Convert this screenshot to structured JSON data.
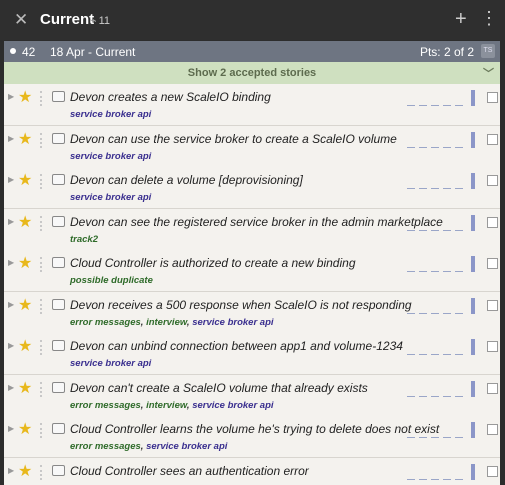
{
  "header": {
    "close": "✕",
    "title": "Current",
    "velocity": "11",
    "add": "+",
    "more": "⋮"
  },
  "iteration": {
    "number": "42",
    "date": "18 Apr - Current",
    "points": "Pts: 2 of 2",
    "ts": "TS"
  },
  "accepted": {
    "label": "Show 2 accepted stories"
  },
  "colors": {
    "star": "#e8b81c",
    "label_green": "#2f6b2a",
    "label_blue": "#3a2f8f",
    "accepted_bg": "#cfe0c0",
    "iteration_bg": "#6e7582"
  },
  "stories": [
    {
      "name": "Devon creates a new ScaleIO binding",
      "labels": [
        {
          "text": "service broker api",
          "color": "blue"
        }
      ]
    },
    {
      "name": "Devon can use the service broker to create a ScaleIO volume",
      "labels": [
        {
          "text": "service broker api",
          "color": "blue"
        }
      ]
    },
    {
      "name": "Devon can delete a volume [deprovisioning]",
      "labels": [
        {
          "text": "service broker api",
          "color": "blue"
        }
      ]
    },
    {
      "name": "Devon can see the registered service broker in the admin marketplace",
      "labels": [
        {
          "text": "track2",
          "color": "green"
        }
      ]
    },
    {
      "name": "Cloud Controller is authorized to create a new binding",
      "labels": [
        {
          "text": "possible duplicate",
          "color": "green"
        }
      ]
    },
    {
      "name": "Devon receives a 500 response when ScaleIO is not responding",
      "labels": [
        {
          "text": "error messages",
          "color": "green"
        },
        {
          "text": "interview",
          "color": "green"
        },
        {
          "text": "service broker api",
          "color": "blue"
        }
      ]
    },
    {
      "name": "Devon can unbind connection between app1 and volume-1234",
      "labels": [
        {
          "text": "service broker api",
          "color": "blue"
        }
      ]
    },
    {
      "name": "Devon can't create a ScaleIO volume that already exists",
      "labels": [
        {
          "text": "error messages",
          "color": "green"
        },
        {
          "text": "interview",
          "color": "green"
        },
        {
          "text": "service broker api",
          "color": "blue"
        }
      ]
    },
    {
      "name": "Cloud Controller learns the volume he's trying to delete does not exist",
      "labels": [
        {
          "text": "error messages",
          "color": "green"
        },
        {
          "text": "service broker api",
          "color": "blue"
        }
      ]
    },
    {
      "name": "Cloud Controller sees an authentication error",
      "labels": []
    }
  ]
}
